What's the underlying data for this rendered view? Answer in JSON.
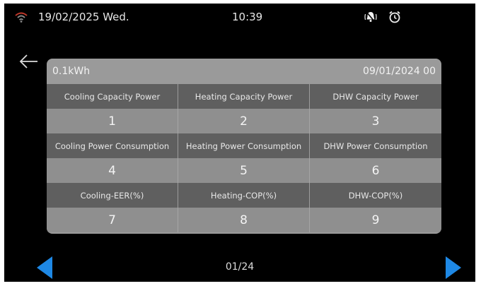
{
  "status": {
    "date": "19/02/2025 Wed.",
    "time": "10:39",
    "wifi_icon": "wifi-icon",
    "alarm_icon": "bell-off-icon",
    "clock_icon": "alarm-clock-icon"
  },
  "panel": {
    "unit": "0.1kWh",
    "timestamp": "09/01/2024 00",
    "rows": [
      {
        "headers": [
          "Cooling Capacity Power",
          "Heating Capacity Power",
          "DHW Capacity Power"
        ],
        "values": [
          "1",
          "2",
          "3"
        ]
      },
      {
        "headers": [
          "Cooling Power Consumption",
          "Heating Power Consumption",
          "DHW Power Consumption"
        ],
        "values": [
          "4",
          "5",
          "6"
        ]
      },
      {
        "headers": [
          "Cooling-EER(%)",
          "Heating-COP(%)",
          "DHW-COP(%)"
        ],
        "values": [
          "7",
          "8",
          "9"
        ]
      }
    ]
  },
  "pager": {
    "page": "01/24"
  },
  "colors": {
    "arrow": "#1e88e5",
    "panel": "#9a9a9a",
    "header_row": "#5f5f5f",
    "screen": "#000000"
  }
}
